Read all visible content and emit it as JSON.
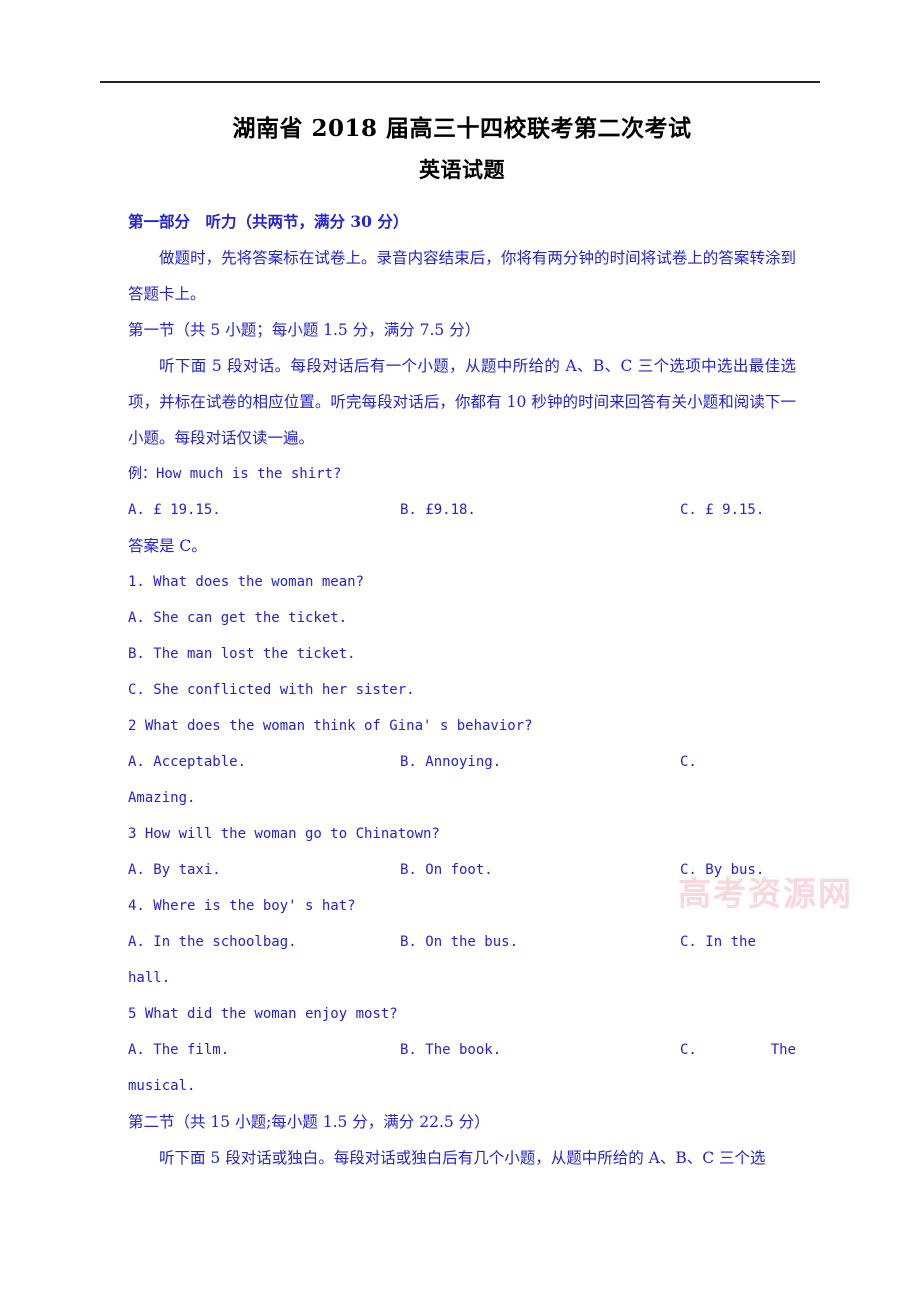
{
  "document": {
    "title": "湖南省 2018 届高三十四校联考第二次考试",
    "subtitle": "英语试题",
    "watermark": "高考资源网"
  },
  "colors": {
    "body_text": "#2222dd",
    "title_text": "#000000",
    "rule": "#232323",
    "watermark": "#f3b8c4",
    "background": "#ffffff"
  },
  "sections": {
    "part_one_heading": "第一部分　听力（共两节，满分 30 分）",
    "part_one_instruction": "做题时，先将答案标在试卷上。录音内容结束后，你将有两分钟的时间将试卷上的答案转涂到答题卡上。",
    "section_one_heading": "第一节（共 5 小题；每小题 1.5 分，满分 7.5 分）",
    "section_one_instruction": "听下面 5 段对话。每段对话后有一个小题，从题中所给的 A、B、C 三个选项中选出最佳选项，并标在试卷的相应位置。听完每段对话后，你都有 10 秒钟的时间来回答有关小题和阅读下一小题。每段对话仅读一遍。",
    "section_two_heading": "第二节（共 15 小题;每小题 1.5 分，满分 22.5 分）",
    "section_two_instruction": "听下面 5 段对话或独白。每段对话或独白后有几个小题，从题中所给的 A、B、C 三个选"
  },
  "example": {
    "stem": "例：How much is the shirt?",
    "option_a": "A. £ 19.15.",
    "option_b": "B. £9.18.",
    "option_c": "C. £ 9.15.",
    "answer_line": "答案是 C。"
  },
  "questions": [
    {
      "stem": "1. What does the woman mean?",
      "layout": "stacked",
      "options": [
        "A. She can get the ticket.",
        "B. The man lost the ticket.",
        "C. She conflicted with her sister."
      ]
    },
    {
      "stem": "2 What does the woman think of Gina' s behavior?",
      "layout": "row-wrap",
      "option_a": "A. Acceptable.",
      "option_b": "B. Annoying.",
      "option_c_letter": "C.",
      "option_c_text": "",
      "continuation": "Amazing."
    },
    {
      "stem": "3 How will the woman go to Chinatown?",
      "layout": "row",
      "option_a": "A. By taxi.",
      "option_b": "B. On foot.",
      "option_c": "C. By bus."
    },
    {
      "stem": "4. Where is the boy' s hat?",
      "layout": "row-wrap",
      "option_a": "A. In the schoolbag.",
      "option_b": "B. On the bus.",
      "option_c_letter": "C.",
      "option_c_text": "In the",
      "continuation": "hall."
    },
    {
      "stem": "5 What did the woman enjoy most?",
      "layout": "row-wrap",
      "option_a": "A. The film.",
      "option_b": "B. The book.",
      "option_c_letter": "C.",
      "option_c_text": "The",
      "continuation": "musical."
    }
  ]
}
